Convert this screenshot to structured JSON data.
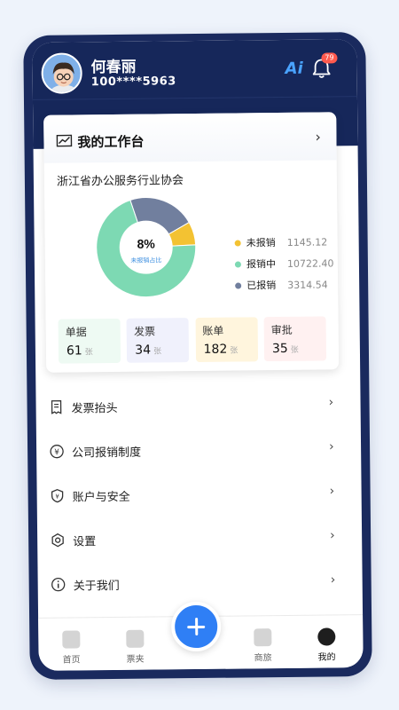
{
  "header": {
    "user_name": "何春丽",
    "user_phone": "100****5963",
    "ai_label": "Ai",
    "notification_count": "79"
  },
  "workbench": {
    "title": "我的工作台",
    "organization": "浙江省办公服务行业协会",
    "center_value": "8%",
    "center_label": "未报销占比",
    "legend": [
      {
        "label": "未报销",
        "value": "1145.12",
        "color": "#f3c232"
      },
      {
        "label": "报销中",
        "value": "10722.40",
        "color": "#7dd9b3"
      },
      {
        "label": "已报销",
        "value": "3314.54",
        "color": "#717f9e"
      }
    ],
    "tiles": [
      {
        "title": "单据",
        "count": "61",
        "unit": "张",
        "bg": "#eefaf3"
      },
      {
        "title": "发票",
        "count": "34",
        "unit": "张",
        "bg": "#f0f1fc"
      },
      {
        "title": "账单",
        "count": "182",
        "unit": "张",
        "bg": "#fff5dd"
      },
      {
        "title": "审批",
        "count": "35",
        "unit": "张",
        "bg": "#fff1f1"
      }
    ]
  },
  "chart_data": {
    "type": "pie",
    "categories": [
      "未报销",
      "报销中",
      "已报销"
    ],
    "values": [
      1145.12,
      10722.4,
      3314.54
    ],
    "colors": [
      "#f3c232",
      "#7dd9b3",
      "#717f9e"
    ],
    "title": "",
    "center_text": "8%",
    "center_subtext": "未报销占比"
  },
  "menu": {
    "items": [
      {
        "label": "发票抬头",
        "icon": "invoice-icon"
      },
      {
        "label": "公司报销制度",
        "icon": "policy-icon"
      },
      {
        "label": "账户与安全",
        "icon": "shield-icon"
      },
      {
        "label": "设置",
        "icon": "gear-icon"
      },
      {
        "label": "关于我们",
        "icon": "info-icon"
      }
    ]
  },
  "tabbar": {
    "home": "首页",
    "ticket_folder": "票夹",
    "travel": "商旅",
    "mine": "我的"
  }
}
